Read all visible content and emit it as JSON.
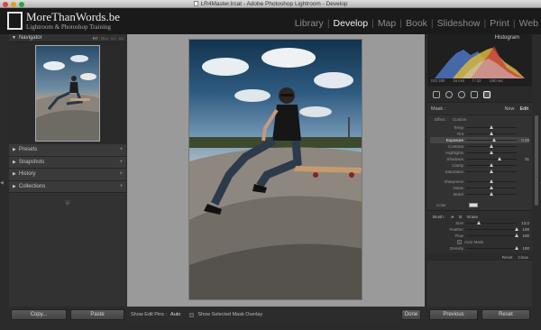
{
  "window": {
    "title": "LR4Master.lrcat - Adobe Photoshop Lightroom - Develop"
  },
  "identity": {
    "brand": "MoreThanWords.be",
    "tagline": "Lightroom & Photoshop Training"
  },
  "modules": [
    "Library",
    "Develop",
    "Map",
    "Book",
    "Slideshow",
    "Print",
    "Web"
  ],
  "active_module": "Develop",
  "navigator": {
    "label": "Navigator",
    "zooms": [
      "FIT",
      "FILL",
      "1:1",
      "3:1"
    ]
  },
  "left_sections": [
    {
      "label": "Presets",
      "action": "+"
    },
    {
      "label": "Snapshots",
      "action": "+"
    },
    {
      "label": "History",
      "action": "×"
    },
    {
      "label": "Collections",
      "action": "+"
    }
  ],
  "left_buttons": {
    "copy": "Copy...",
    "paste": "Paste"
  },
  "toolbar": {
    "show_pins_label": "Show Edit Pins :",
    "show_pins_value": "Auto",
    "overlay_label": "Show Selected Mask Overlay",
    "done_label": "Done"
  },
  "histogram": {
    "title": "Histogram",
    "iso": "ISO 200",
    "focal": "16 mm",
    "aperture": "f / 22",
    "shutter": "1/60 sec"
  },
  "mask": {
    "label": "Mask :",
    "new": "New",
    "edit": "Edit"
  },
  "effect": {
    "label": "Effect :",
    "value": "Custom"
  },
  "sliders": [
    {
      "label": "Temp",
      "value": "",
      "pos": 0.5
    },
    {
      "label": "Tint",
      "value": "",
      "pos": 0.5
    },
    {
      "label": "Exposure",
      "value": "0.25",
      "pos": 0.55,
      "highlight": true
    },
    {
      "label": "Contrast",
      "value": "",
      "pos": 0.5
    },
    {
      "label": "Highlights",
      "value": "",
      "pos": 0.5
    },
    {
      "label": "Shadows",
      "value": "31",
      "pos": 0.66
    },
    {
      "label": "Clarity",
      "value": "",
      "pos": 0.5
    },
    {
      "label": "Saturation",
      "value": "",
      "pos": 0.5
    },
    {
      "label": "Sharpness",
      "value": "",
      "pos": 0.5
    },
    {
      "label": "Noise",
      "value": "",
      "pos": 0.5
    },
    {
      "label": "Moiré",
      "value": "",
      "pos": 0.5
    }
  ],
  "color_label": "Color",
  "brush": {
    "label": "Brush :",
    "a": "A",
    "b": "B",
    "erase": "Erase",
    "rows": [
      {
        "label": "Size",
        "value": "13,0",
        "pos": 0.25
      },
      {
        "label": "Feather",
        "value": "100",
        "pos": 1.0
      },
      {
        "label": "Flow",
        "value": "100",
        "pos": 1.0
      }
    ],
    "automask": "Auto Mask",
    "density_label": "Density",
    "density_value": "100",
    "density_pos": 1.0
  },
  "panel_foot": {
    "reset": "Reset",
    "close": "Close"
  },
  "right_buttons": {
    "previous": "Previous",
    "reset": "Reset"
  },
  "colors": {
    "accent": "#f0f0f0",
    "panel": "#323232",
    "background": "#9a9a9a"
  }
}
